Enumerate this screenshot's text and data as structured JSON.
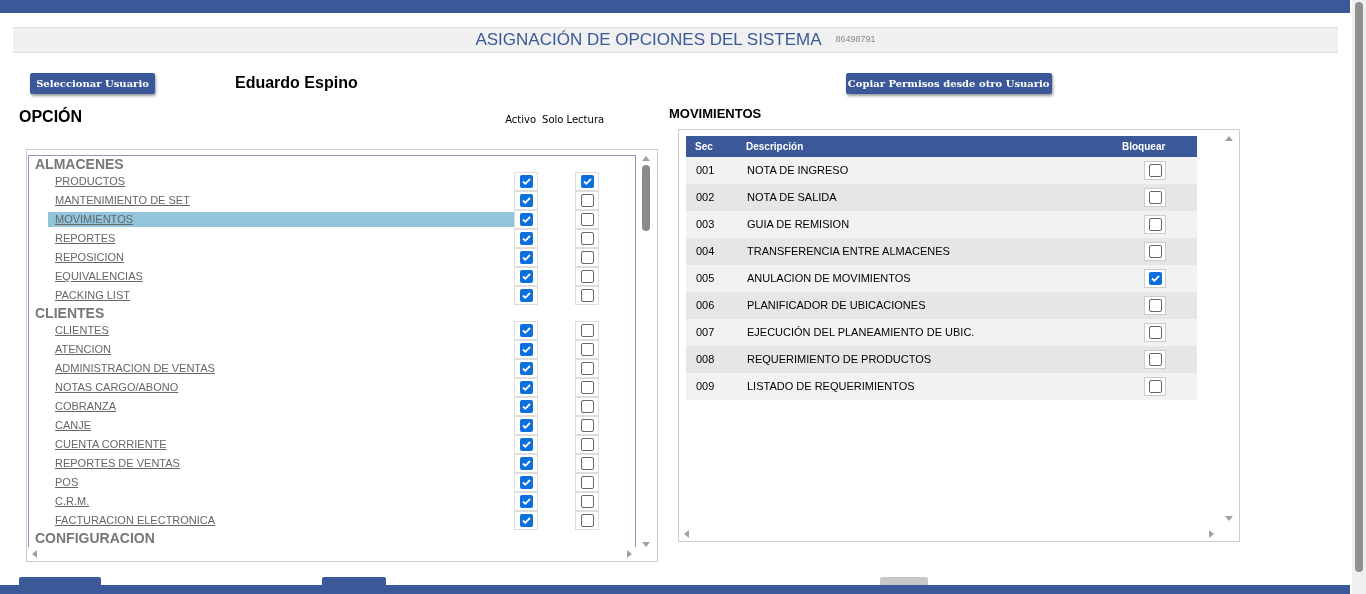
{
  "title": "ASIGNACIÓN DE OPCIONES DEL SISTEMA",
  "code": "86498791",
  "select_button": "Seleccionar Usuario",
  "user_name": "Eduardo Espino",
  "copy_button": "Copiar Permisos desde otro Usuario",
  "options": {
    "heading": "OPCIÓN",
    "col_active": "Activo",
    "col_readonly": "Solo Lectura",
    "groups": [
      {
        "label": "ALMACENES",
        "items": [
          {
            "label": "PRODUCTOS",
            "selected": false,
            "active": true,
            "read_only": true
          },
          {
            "label": "MANTENIMIENTO DE SET",
            "selected": false,
            "active": true,
            "read_only": false
          },
          {
            "label": "MOVIMIENTOS",
            "selected": true,
            "active": true,
            "read_only": false
          },
          {
            "label": "REPORTES",
            "selected": false,
            "active": true,
            "read_only": false
          },
          {
            "label": "REPOSICION",
            "selected": false,
            "active": true,
            "read_only": false
          },
          {
            "label": "EQUIVALENCIAS",
            "selected": false,
            "active": true,
            "read_only": false
          },
          {
            "label": "PACKING LIST",
            "selected": false,
            "active": true,
            "read_only": false
          }
        ]
      },
      {
        "label": "CLIENTES",
        "items": [
          {
            "label": "CLIENTES",
            "selected": false,
            "active": true,
            "read_only": false
          },
          {
            "label": "ATENCION",
            "selected": false,
            "active": true,
            "read_only": false
          },
          {
            "label": "ADMINISTRACION DE VENTAS",
            "selected": false,
            "active": true,
            "read_only": false
          },
          {
            "label": "NOTAS CARGO/ABONO",
            "selected": false,
            "active": true,
            "read_only": false
          },
          {
            "label": "COBRANZA",
            "selected": false,
            "active": true,
            "read_only": false
          },
          {
            "label": "CANJE",
            "selected": false,
            "active": true,
            "read_only": false
          },
          {
            "label": "CUENTA CORRIENTE",
            "selected": false,
            "active": true,
            "read_only": false
          },
          {
            "label": "REPORTES DE VENTAS",
            "selected": false,
            "active": true,
            "read_only": false
          },
          {
            "label": "POS",
            "selected": false,
            "active": true,
            "read_only": false
          },
          {
            "label": "C.R.M.",
            "selected": false,
            "active": true,
            "read_only": false
          },
          {
            "label": "FACTURACION ELECTRONICA",
            "selected": false,
            "active": true,
            "read_only": false
          }
        ]
      },
      {
        "label": "CONFIGURACION"
      }
    ]
  },
  "movements": {
    "heading": "MOVIMIENTOS",
    "columns": [
      "Sec",
      "Descripción",
      "Bloquear"
    ],
    "rows": [
      {
        "sec": "001",
        "description": "NOTA DE INGRESO",
        "blocked": false
      },
      {
        "sec": "002",
        "description": "NOTA DE SALIDA",
        "blocked": false
      },
      {
        "sec": "003",
        "description": "GUIA DE REMISION",
        "blocked": false
      },
      {
        "sec": "004",
        "description": "TRANSFERENCIA ENTRE ALMACENES",
        "blocked": false
      },
      {
        "sec": "005",
        "description": "ANULACION DE MOVIMIENTOS",
        "blocked": true
      },
      {
        "sec": "006",
        "description": "PLANIFICADOR DE UBICACIONES",
        "blocked": false
      },
      {
        "sec": "007",
        "description": "EJECUCIÓN DEL PLANEAMIENTO DE UBIC.",
        "blocked": false
      },
      {
        "sec": "008",
        "description": "REQUERIMIENTO DE PRODUCTOS",
        "blocked": false
      },
      {
        "sec": "009",
        "description": "LISTADO DE REQUERIMIENTOS",
        "blocked": false
      }
    ]
  }
}
